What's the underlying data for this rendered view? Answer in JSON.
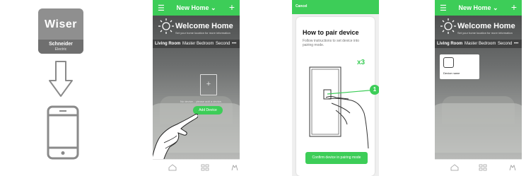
{
  "logo": {
    "wiser": "Wiser",
    "brand": "Schneider",
    "brand_sub": "Electric"
  },
  "app": {
    "home_title": "New Home",
    "welcome": "Welcome Home",
    "welcome_sub": "Set your home location for more information",
    "tabs": [
      "Living Room",
      "Master Bedroom",
      "Second",
      "•••"
    ]
  },
  "empty_state": {
    "message": "No device... please add a device.",
    "add_button": "Add Device"
  },
  "pairing": {
    "cancel": "Cancel",
    "title": "How to pair device",
    "subtitle": "Follow instructions to set device into pairing mode.",
    "press_count": "x3",
    "step_number": "1",
    "confirm_button": "Confirm device in pairing mode"
  },
  "device": {
    "name": "Device name"
  },
  "colors": {
    "accent": "#3dcd58",
    "logo_gray": "#8f8f8f"
  }
}
